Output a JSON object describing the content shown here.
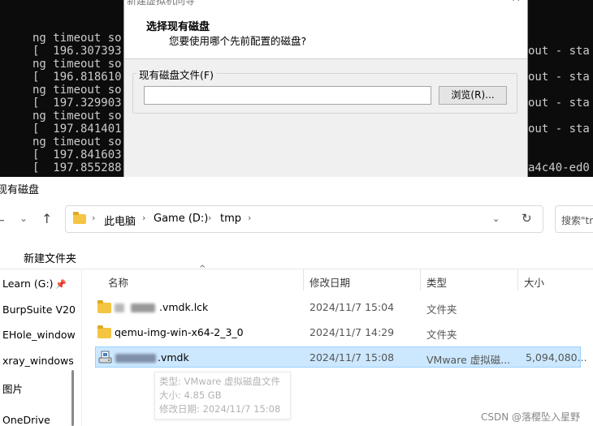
{
  "terminal": {
    "lines": [
      "ng timeout so",
      "[  196.307393",
      "ng timeout so",
      "[  196.818610",
      "ng timeout so",
      "[  197.329903",
      "ng timeout so",
      "[  197.841401",
      "ng timeout so",
      "[  197.841603",
      "[  197.855288"
    ],
    "right_lines": [
      "out - sta",
      "out - sta",
      "out - sta",
      "out - sta",
      "a4c40-ed0"
    ]
  },
  "wizard": {
    "title": "新建虚拟机向导",
    "close_glyph": "✕",
    "heading": "选择现有磁盘",
    "subheading": "您要使用哪个先前配置的磁盘?",
    "group_label": "现有磁盘文件(F)",
    "path_value": "",
    "browse_label": "浏览(R)..."
  },
  "explorer": {
    "title": "现有磁盘",
    "nav": {
      "back": "←",
      "history": "⌄",
      "up": "↑"
    },
    "breadcrumbs": [
      "此电脑",
      "Game (D:)",
      "tmp"
    ],
    "crumb_sep": "›",
    "addr_dropdown": "⌄",
    "refresh": "↻",
    "search_placeholder": "搜索\"tmp\"",
    "toolbar": {
      "new_folder": "新建文件夹"
    },
    "nav_items": [
      "Learn (G:)",
      "BurpSuite V20",
      "EHole_window",
      "xray_windows",
      "图片",
      "OneDrive"
    ],
    "pin_glyph": "📌",
    "sort_glyph": "^",
    "columns": {
      "name": "名称",
      "modified": "修改日期",
      "type": "类型",
      "size": "大小"
    },
    "files": [
      {
        "name": ".vmdk.lck",
        "modified": "2024/11/7 15:04",
        "type": "文件夹",
        "size": "",
        "icon": "folder-icon",
        "blurred": true
      },
      {
        "name": "qemu-img-win-x64-2_3_0",
        "modified": "2024/11/7 14:29",
        "type": "文件夹",
        "size": "",
        "icon": "folder-icon",
        "blurred": false
      },
      {
        "name": ".vmdk",
        "modified": "2024/11/7 15:08",
        "type": "VMware 虚拟磁...",
        "size": "5,094,080...",
        "icon": "vmware-disk-icon",
        "blurred": true,
        "selected": true
      }
    ],
    "tooltip": {
      "type": "类型: VMware 虚拟磁盘文件",
      "size": "大小: 4.85 GB",
      "modified": "修改日期: 2024/11/7 15:08"
    }
  },
  "watermark": "CSDN @落樱坠入星野"
}
